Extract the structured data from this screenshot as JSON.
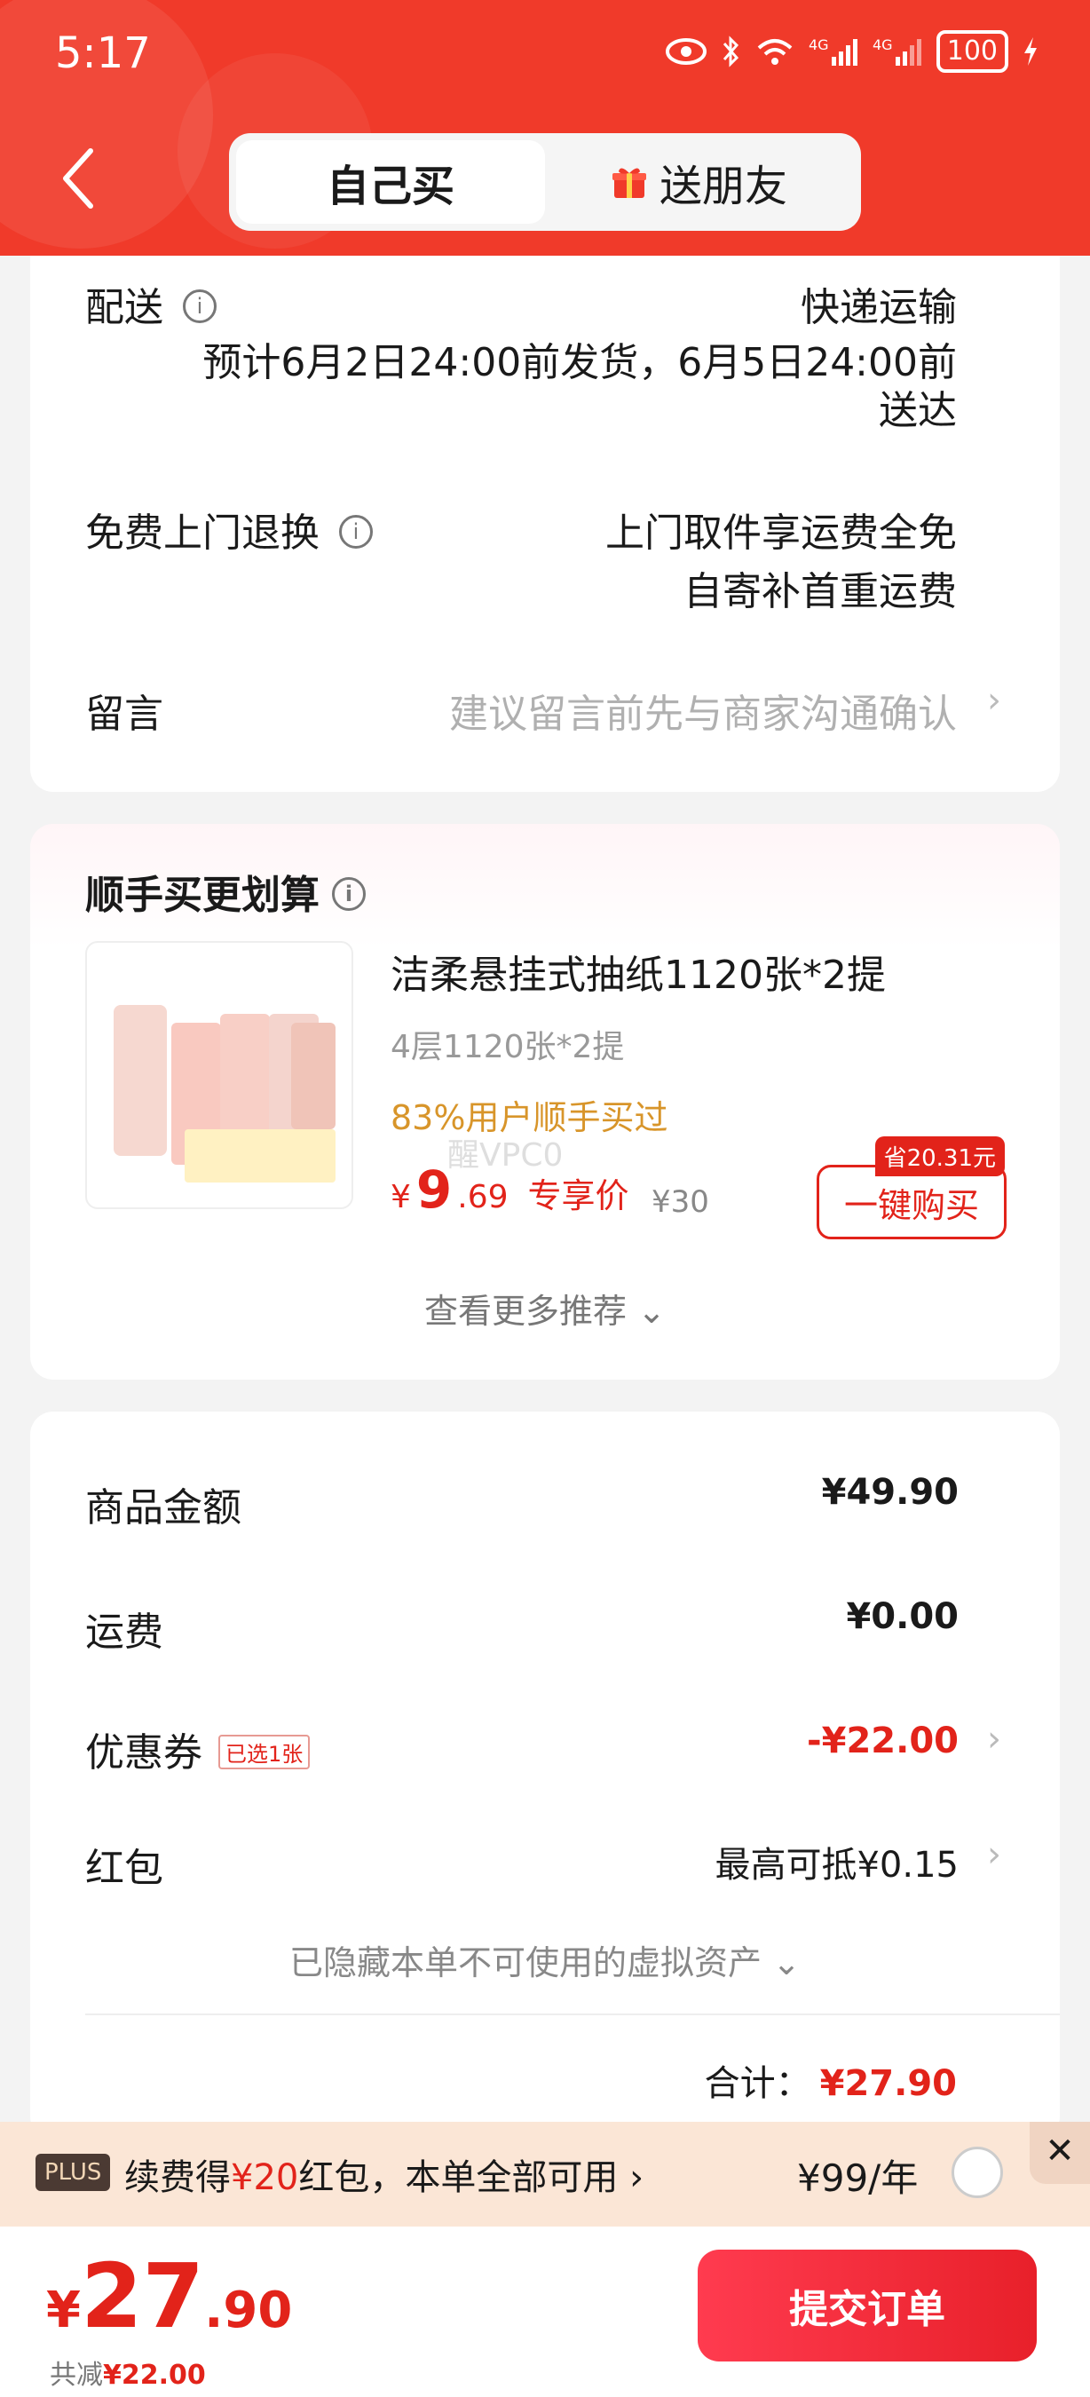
{
  "status_bar": {
    "time": "5:17",
    "battery": "100"
  },
  "header": {
    "tabs": [
      {
        "label": "自己买",
        "active": true
      },
      {
        "label": "送朋友",
        "active": false
      }
    ]
  },
  "delivery": {
    "label": "配送",
    "method": "快递运输",
    "estimate_line1": "预计6月2日24:00前发货，6月5日24:00前",
    "estimate_line2": "送达"
  },
  "returns": {
    "label": "免费上门退换",
    "line1": "上门取件享运费全免",
    "line2": "自寄补首重运费"
  },
  "message": {
    "label": "留言",
    "placeholder": "建议留言前先与商家沟通确认"
  },
  "recommend": {
    "title": "顺手买更划算",
    "product_name": "洁柔悬挂式抽纸1120张*2提",
    "spec": "4层1120张*2提",
    "bought_text": "83%用户顺手买过",
    "price_currency": "¥",
    "price_int": "9",
    "price_dec": ".69",
    "price_tag": "专享价",
    "original_price": "¥30",
    "save_badge": "省20.31元",
    "buy_button": "一键购买",
    "more_label": "查看更多推荐",
    "watermark": "醒VPC0"
  },
  "summary": {
    "goods_label": "商品金额",
    "goods_value": "¥49.90",
    "shipping_label": "运费",
    "shipping_value": "¥0.00",
    "coupon_label": "优惠券",
    "coupon_tag": "已选1张",
    "coupon_value": "-¥22.00",
    "redpacket_label": "红包",
    "redpacket_value": "最高可抵¥0.15",
    "hidden_assets": "已隐藏本单不可使用的虚拟资产",
    "total_label": "合计：",
    "total_value": "¥27.90"
  },
  "plus": {
    "badge": "PLUS",
    "text_pre": "续费得",
    "text_amount": "¥20",
    "text_post": "红包，本单全部可用",
    "price": "¥99/年",
    "close": "✕"
  },
  "footer": {
    "currency": "¥",
    "price_int": "27",
    "price_dec": ".90",
    "saved_label": "共减",
    "saved_value": "¥22.00",
    "submit_label": "提交订单"
  },
  "colors": {
    "brand_red": "#f03a2a",
    "price_red": "#e2231a",
    "plus_bg": "#fbe6d6"
  }
}
